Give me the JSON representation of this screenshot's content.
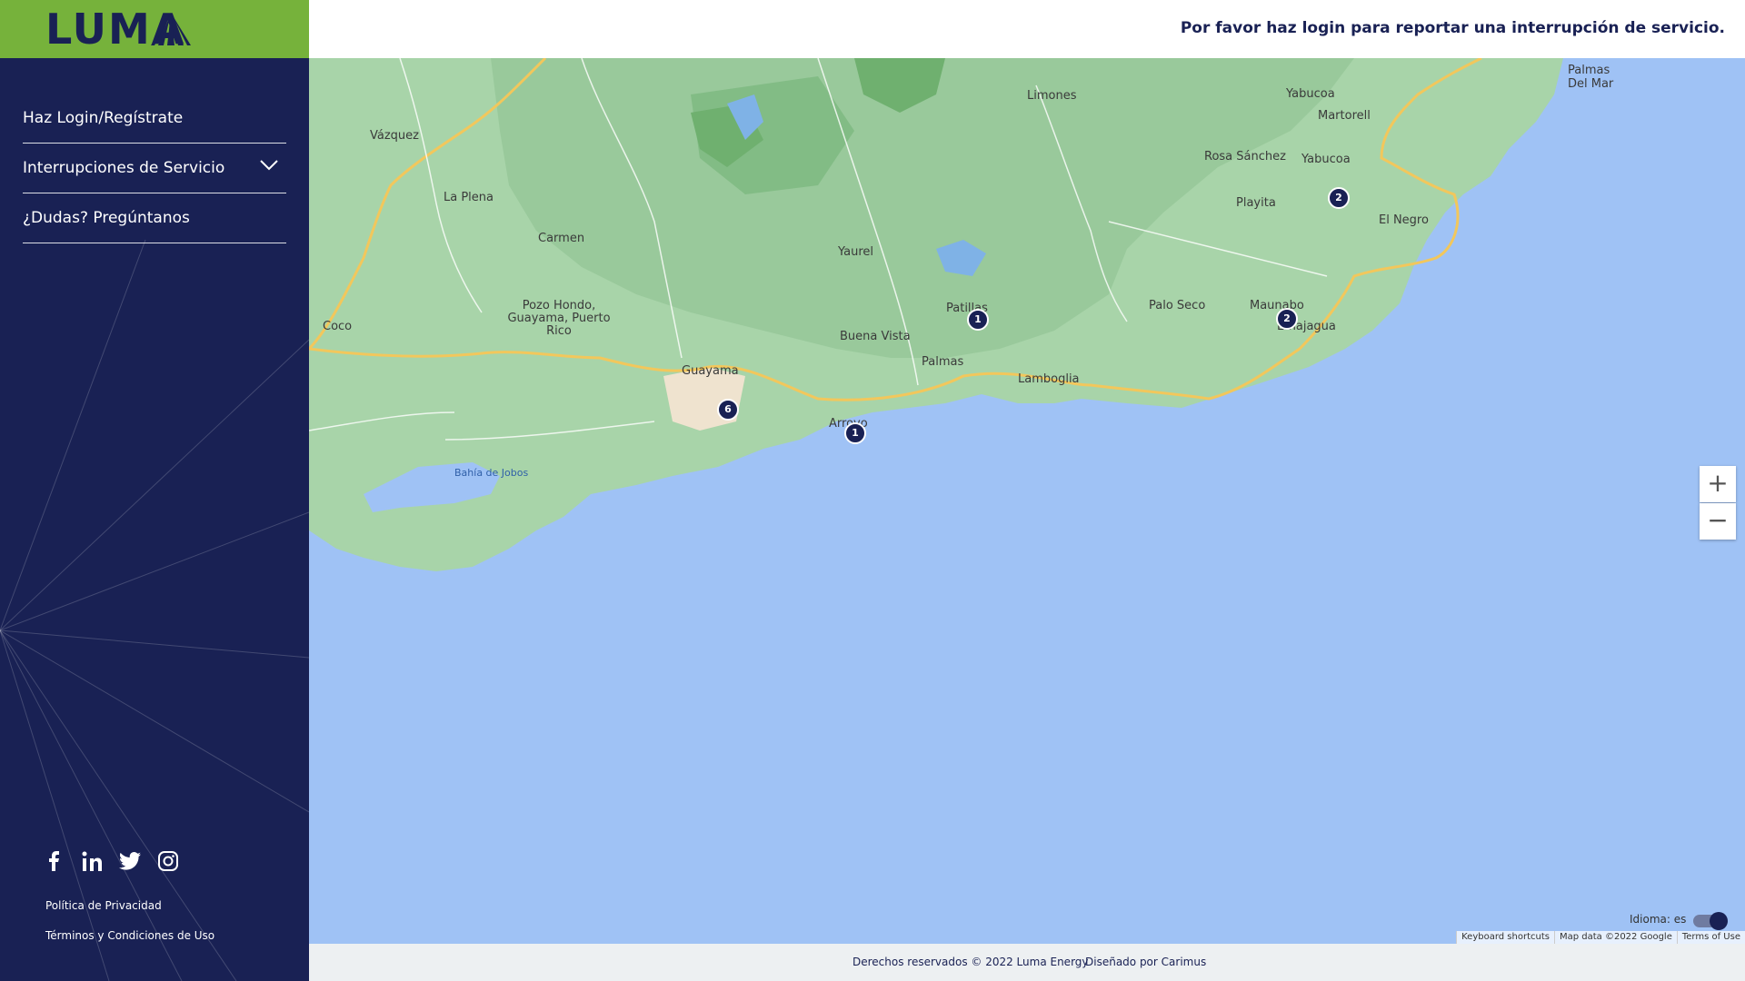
{
  "brand": {
    "logo_text": "LUMA",
    "primary_color": "#192154",
    "accent_color": "#76b23b"
  },
  "header": {
    "login_prompt": "Por favor haz login para reportar una interrupción de servicio."
  },
  "sidebar": {
    "nav": [
      {
        "label": "Haz Login/Regístrate"
      },
      {
        "label": "Interrupciones de Servicio",
        "has_dropdown": true
      },
      {
        "label": "¿Dudas? Pregúntanos"
      }
    ],
    "social": [
      "facebook-icon",
      "linkedin-icon",
      "twitter-icon",
      "instagram-icon"
    ],
    "links": {
      "privacy": "Política de Privacidad",
      "terms": "Términos y Condiciones de Uso"
    }
  },
  "map": {
    "places": [
      "Yabucoa",
      "Limones",
      "Martorell",
      "Rosa Sánchez",
      "Playita",
      "Yabucoa",
      "El Negro",
      "Maunabo",
      "Emajagua",
      "Palo Seco",
      "Patillas",
      "Yaurel",
      "Buena Vista",
      "Palmas",
      "Lamboglia",
      "Arroyo",
      "Guayama",
      "Carmen",
      "La Plena",
      "Vázquez",
      "Pozo Hondo, Guayama, Puerto Rico",
      "Coco",
      "Bahía de Jobos",
      "Palmas Del Mar"
    ],
    "markers": [
      {
        "count": "2"
      },
      {
        "count": "2"
      },
      {
        "count": "1"
      },
      {
        "count": "6"
      },
      {
        "count": "1"
      }
    ],
    "zoom_in": "+",
    "zoom_out": "−",
    "language_label": "Idioma: es",
    "attribution": [
      "Keyboard shortcuts",
      "Map data ©2022 Google",
      "Terms of Use"
    ]
  },
  "footer": {
    "copyright": "Derechos reservados © 2022 Luma Energy",
    "designed_by": "Diseñado por Carimus"
  }
}
